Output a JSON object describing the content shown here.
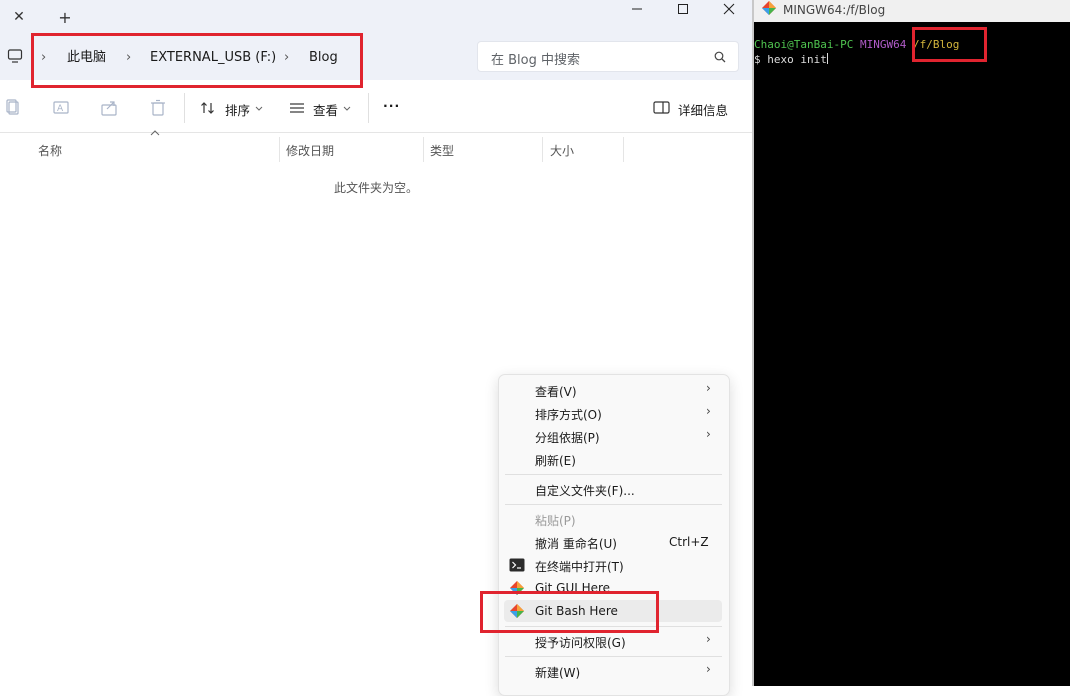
{
  "explorer": {
    "tab_close": "✕",
    "tab_new": "+",
    "window_controls": {
      "minimize": "—",
      "maximize": "☐",
      "close": "✕"
    },
    "breadcrumb": [
      "此电脑",
      "EXTERNAL_USB (F:)",
      "Blog"
    ],
    "breadcrumb_separator": "›",
    "search_placeholder": "在 Blog 中搜索",
    "toolbar": {
      "sort": "排序",
      "view": "查看",
      "more": "···",
      "details": "详细信息"
    },
    "columns": [
      "名称",
      "修改日期",
      "类型",
      "大小"
    ],
    "empty_message": "此文件夹为空。"
  },
  "context_menu": {
    "items": [
      {
        "label": "查看(V)",
        "submenu": true
      },
      {
        "label": "排序方式(O)",
        "submenu": true
      },
      {
        "label": "分组依据(P)",
        "submenu": true
      },
      {
        "label": "刷新(E)"
      },
      {
        "label": "自定义文件夹(F)..."
      },
      {
        "label": "粘贴(P)",
        "disabled": true
      },
      {
        "label": "撤消 重命名(U)",
        "shortcut": "Ctrl+Z"
      },
      {
        "label": "在终端中打开(T)",
        "icon": "terminal-icon"
      },
      {
        "label": "Git GUI Here",
        "icon": "git-icon"
      },
      {
        "label": "Git Bash Here",
        "icon": "git-icon",
        "highlighted": true
      },
      {
        "label": "授予访问权限(G)",
        "submenu": true
      },
      {
        "label": "新建(W)",
        "submenu": true
      }
    ],
    "submenu_arrow": "›"
  },
  "terminal": {
    "title": "MINGW64:/f/Blog",
    "prompt_user_host": "Chaoi@TanBai-PC",
    "prompt_env": "MINGW64",
    "prompt_path": "/f/Blog",
    "command_line": "$ hexo init"
  },
  "colors": {
    "highlight_box": "#e0242f",
    "prompt_user": "#4fc34f",
    "prompt_env": "#b05cc8",
    "prompt_path": "#d4b63c",
    "terminal_bg": "#000000"
  }
}
